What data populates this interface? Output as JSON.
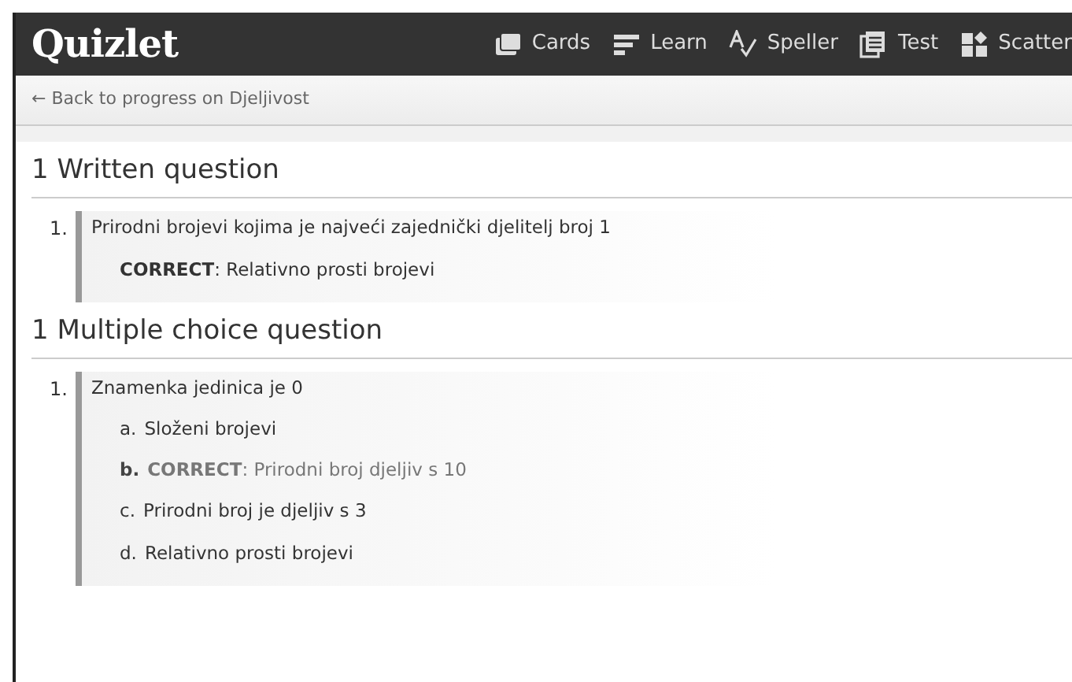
{
  "logo": "Quizlet",
  "nav": [
    {
      "label": "Cards"
    },
    {
      "label": "Learn"
    },
    {
      "label": "Speller"
    },
    {
      "label": "Test"
    },
    {
      "label": "Scatter"
    }
  ],
  "back_link": "← Back to progress on Djeljivost",
  "sections": [
    {
      "kind": "written",
      "title": "1 Written question",
      "questions": [
        {
          "number": "1.",
          "prompt": "Prirodni brojevi kojima je najveći zajednički djelitelj broj 1",
          "answer": "**CORRECT**: Relativno prosti brojevi"
        }
      ]
    },
    {
      "kind": "choice",
      "title": "1 Multiple choice question",
      "questions": [
        {
          "number": "1.",
          "prompt": "Znamenka jedinica je 0",
          "choices": [
            {
              "letter": "a.",
              "text": "Složeni brojevi",
              "correct": false
            },
            {
              "letter": "b.",
              "text": "**CORRECT**: Prirodni broj djeljiv s 10",
              "correct": true
            },
            {
              "letter": "c.",
              "text": "Prirodni broj je djeljiv s 3",
              "correct": false
            },
            {
              "letter": "d.",
              "text": "Relativno prosti brojevi",
              "correct": false
            }
          ]
        }
      ]
    }
  ]
}
